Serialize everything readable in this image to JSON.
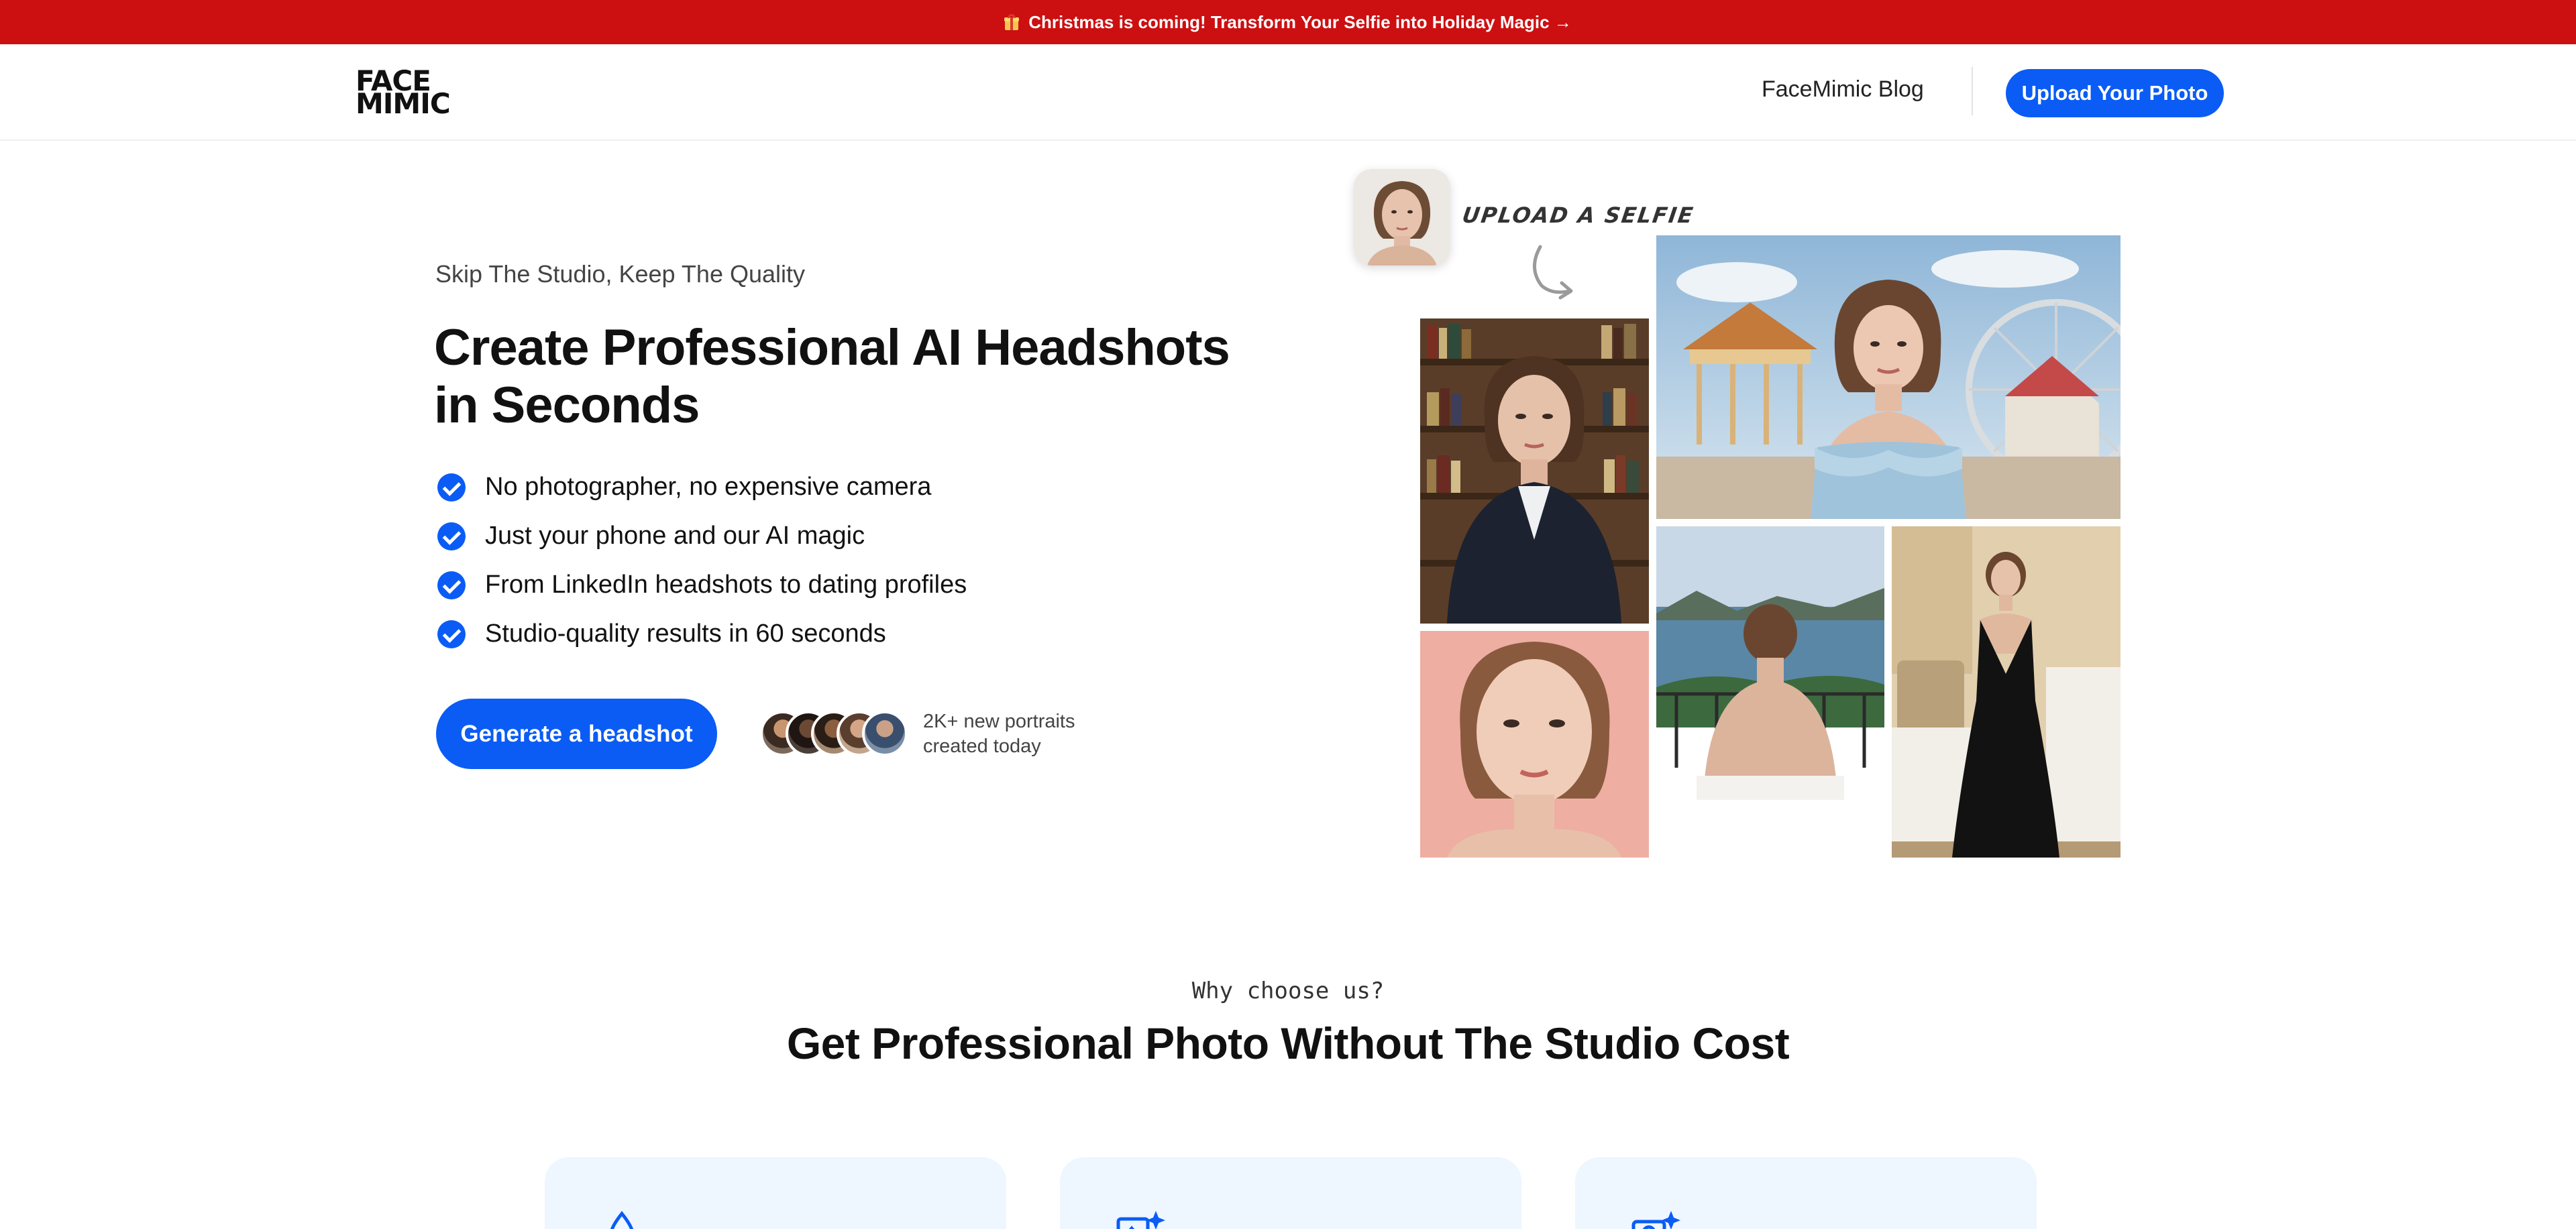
{
  "banner": {
    "text": "Christmas is coming! Transform Your Selfie into Holiday Magic →",
    "icon": "gift-icon",
    "background": "#cc0f11"
  },
  "header": {
    "logo_line1": "FACE",
    "logo_line2": "MIMIC",
    "blog_link": "FaceMimic Blog",
    "upload_button": "Upload Your Photo",
    "accent": "#0a5cf5"
  },
  "hero": {
    "eyebrow": "Skip The Studio, Keep The Quality",
    "title_line1": "Create Professional AI Headshots",
    "title_line2": "in Seconds",
    "features": [
      "No photographer, no expensive camera",
      "Just your phone and our AI magic",
      "From LinkedIn headshots to dating profiles",
      "Studio-quality results in 60 seconds"
    ],
    "cta": "Generate a headshot",
    "social_proof_line1": "2K+ new portraits",
    "social_proof_line2": "created today"
  },
  "collage": {
    "upload_label": "UPLOAD A SELFIE",
    "arrow_icon": "curved-arrow-icon"
  },
  "why": {
    "eyebrow": "Why choose us?",
    "title": "Get Professional Photo Without The Studio Cost",
    "card_icons": [
      "droplet-icon",
      "image-sparkle-icon",
      "camera-sparkle-icon"
    ]
  }
}
